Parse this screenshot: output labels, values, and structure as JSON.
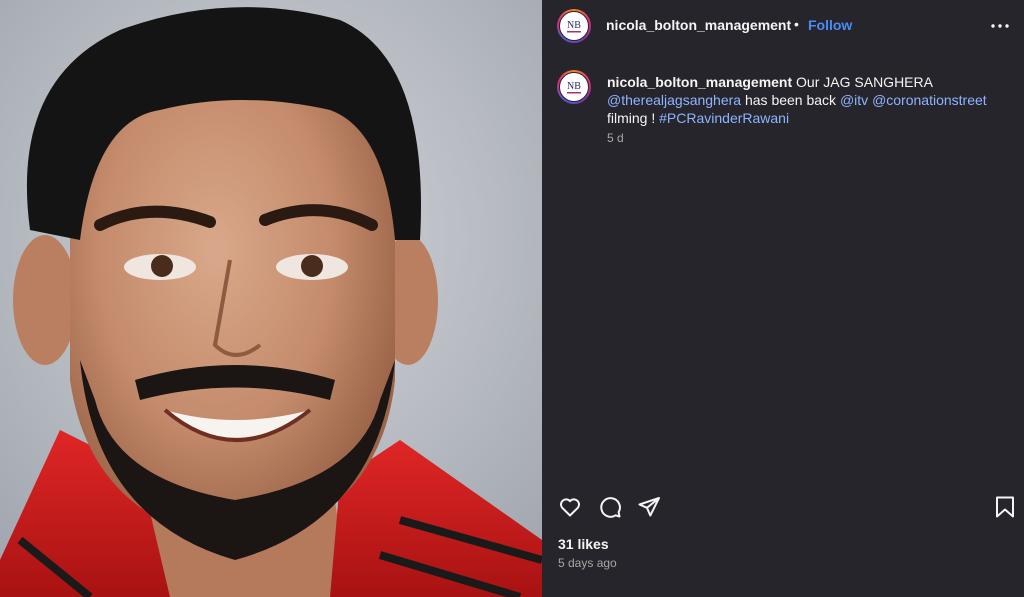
{
  "post": {
    "photo_alt": "Portrait of a smiling bearded man in a red jacket",
    "account": {
      "username": "nicola_bolton_management",
      "avatar_monogram": "NB",
      "follow_label": "Follow",
      "separator": "•"
    },
    "caption": {
      "author": "nicola_bolton_management",
      "text_1": " Our JAG SANGHERA ",
      "mention_1": "@therealjagsanghera",
      "text_2": " has been back ",
      "mention_2": "@itv",
      "text_3": " ",
      "mention_3": "@coronationstreet",
      "text_4": " filming ! ",
      "hashtag_1": "#PCRavinderRawani",
      "time": "5 d"
    },
    "actions": {
      "like": "heart-icon",
      "comment": "comment-icon",
      "share": "paper-plane-icon",
      "save": "bookmark-icon"
    },
    "likes_label": "31 likes",
    "age_label": "5 days ago"
  },
  "colors": {
    "panel_bg": "#25252b",
    "follow_blue": "#4a8cf7",
    "mention_blue": "#8fb4ff",
    "muted_text": "#a8a8a8"
  }
}
